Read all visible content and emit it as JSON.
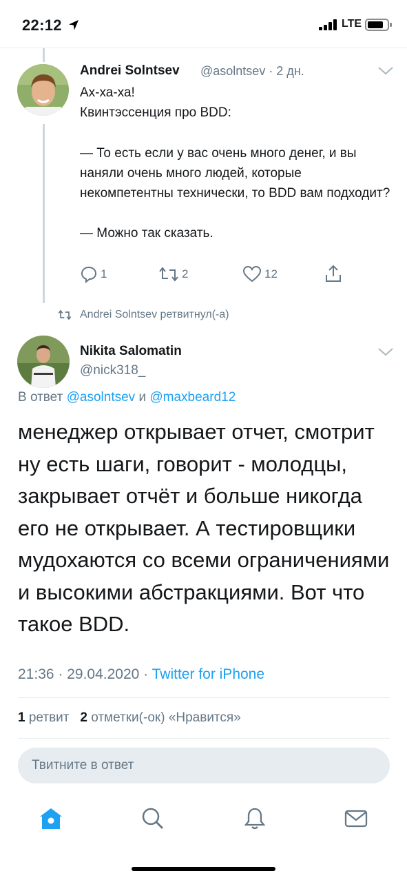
{
  "colors": {
    "accent": "#1da1f2",
    "secondary_text": "#657786",
    "primary_text": "#14171a",
    "divider": "#e6ecf0"
  },
  "status_bar": {
    "time": "22:12",
    "network": "LTE"
  },
  "parent_tweet": {
    "author_name": "Andrei Solntsev",
    "handle_time": "@asolntsev · 2 дн.",
    "text": "Ах-ха-ха!\nКвинтэссенция про BDD:\n\n— То есть если у вас очень много денег, и вы наняли очень много людей, которые некомпетентны технически, то BDD вам подходит?\n\n— Можно так сказать.",
    "reply_count": "1",
    "retweet_count": "2",
    "like_count": "12"
  },
  "retweet_context": {
    "text": "Andrei Solntsev ретвитнул(-а)"
  },
  "main_tweet": {
    "author_name": "Nikita Salomatin",
    "handle": "@nick318_",
    "reply_prefix": "В ответ",
    "reply_user_1": "@asolntsev",
    "reply_conjunction": "и",
    "reply_user_2": "@maxbeard12",
    "text": "менеджер открывает отчет, смотрит ну есть шаги, говорит - молодцы, закрывает отчёт и больше никогда его не открывает. А тестировщики мудохаются со всеми ограничениями и высокими абстракциями. Вот что такое BDD.",
    "datetime": "21:36 · 29.04.2020 ·",
    "source": "Twitter for iPhone",
    "retweets_count": "1",
    "retweets_label": "ретвит",
    "likes_count": "2",
    "likes_label": "отметки(-ок) «Нравится»"
  },
  "reply_input": {
    "placeholder": "Твитните в ответ"
  },
  "tab_bar": [
    {
      "icon": "home-icon",
      "active": true
    },
    {
      "icon": "search-icon",
      "active": false
    },
    {
      "icon": "bell-icon",
      "active": false
    },
    {
      "icon": "mail-icon",
      "active": false
    }
  ]
}
